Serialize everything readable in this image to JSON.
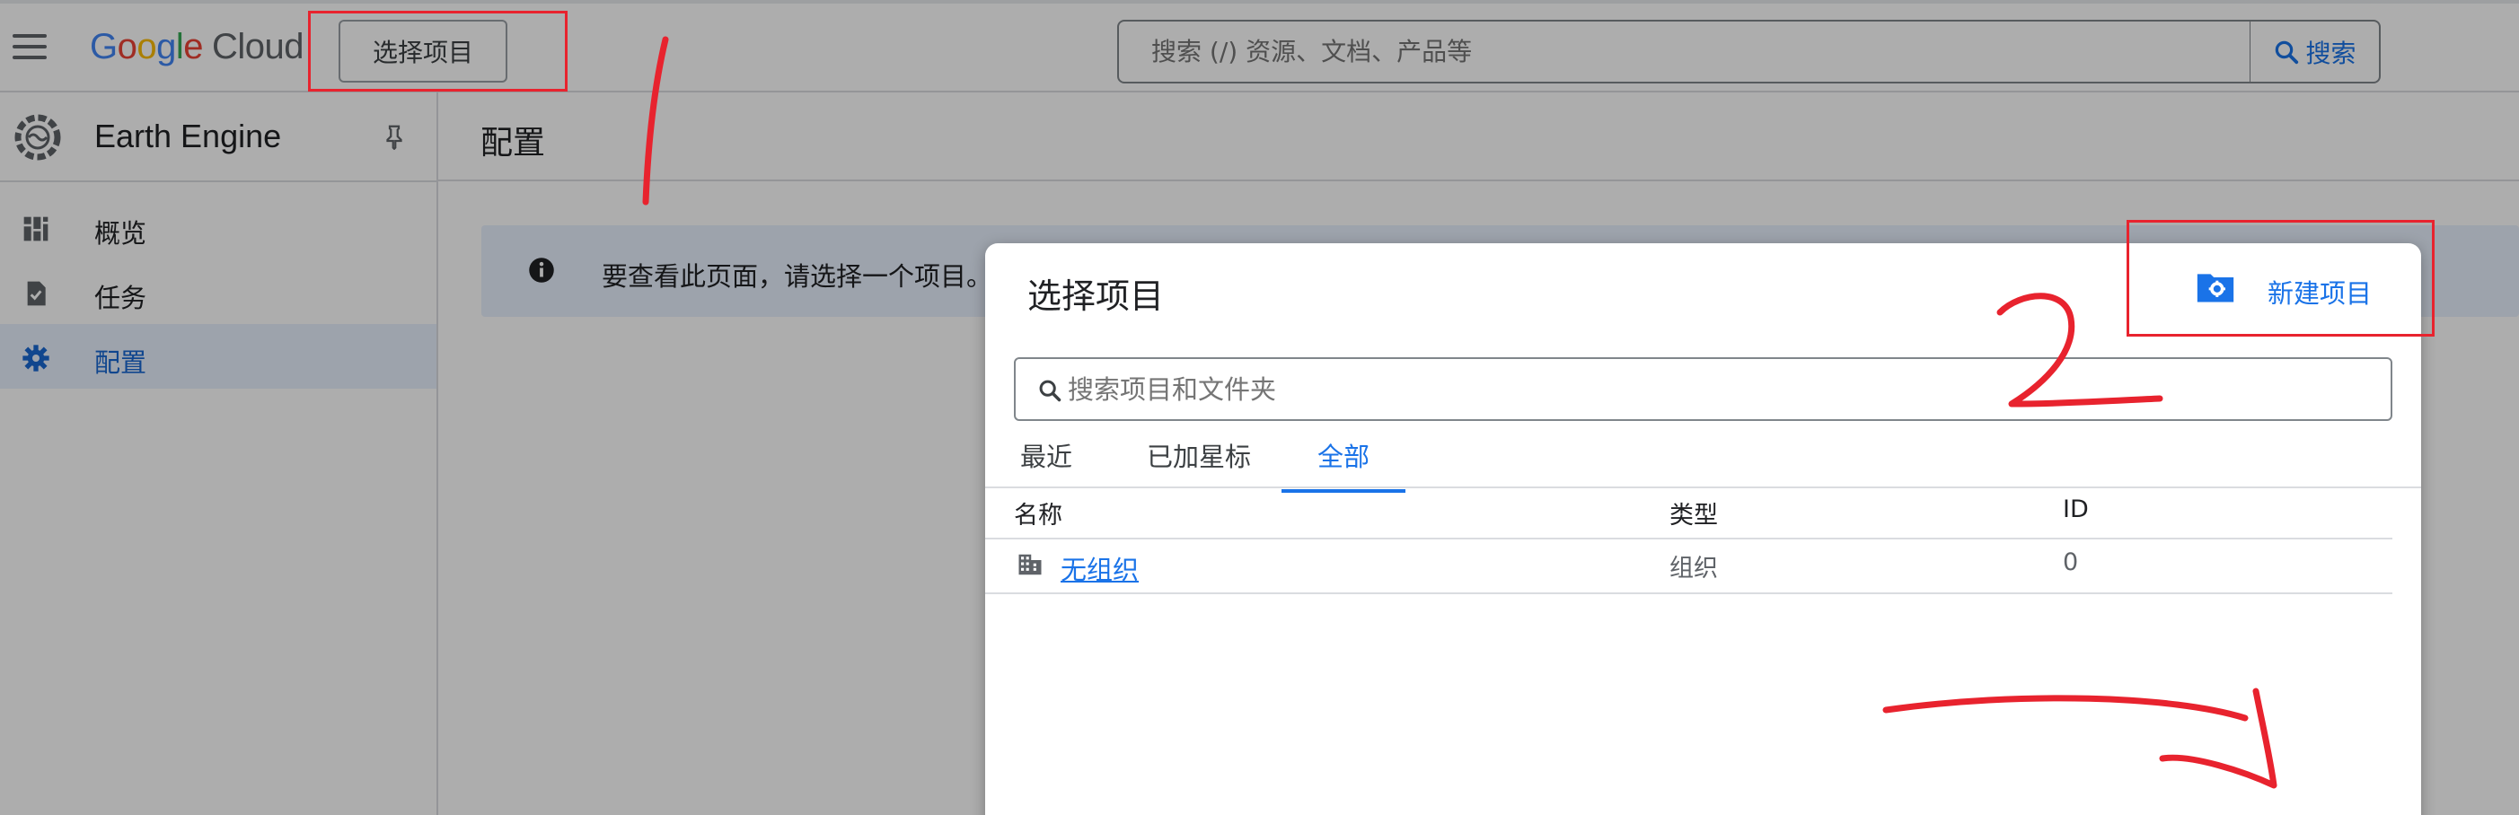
{
  "topbar": {
    "logo_google": [
      "G",
      "o",
      "o",
      "g",
      "l",
      "e"
    ],
    "logo_cloud": "Cloud",
    "project_button": "选择项目",
    "search_placeholder": "搜索 (/) 资源、文档、产品等",
    "search_button": "搜索"
  },
  "sidebar": {
    "product": "Earth Engine",
    "items": [
      {
        "label": "概览",
        "icon": "dashboard-icon",
        "active": false
      },
      {
        "label": "任务",
        "icon": "task-icon",
        "active": false
      },
      {
        "label": "配置",
        "icon": "gear-icon",
        "active": true
      }
    ]
  },
  "main": {
    "page_title": "配置",
    "info_message": "要查看此页面，请选择一个项目。"
  },
  "dialog": {
    "title": "选择项目",
    "new_project": "新建项目",
    "search_placeholder": "搜索项目和文件夹",
    "tabs": [
      {
        "label": "最近",
        "active": false
      },
      {
        "label": "已加星标",
        "active": false
      },
      {
        "label": "全部",
        "active": true
      }
    ],
    "columns": [
      "名称",
      "类型",
      "ID"
    ],
    "rows": [
      {
        "name": "无组织",
        "type": "组织",
        "id": "0"
      }
    ]
  },
  "colors": {
    "accent": "#1a73e8",
    "annotation_red": "#e8232e",
    "sidebar_active_bg": "#e8f0fe"
  },
  "annotations": {
    "step1": "1",
    "step2": "2"
  }
}
